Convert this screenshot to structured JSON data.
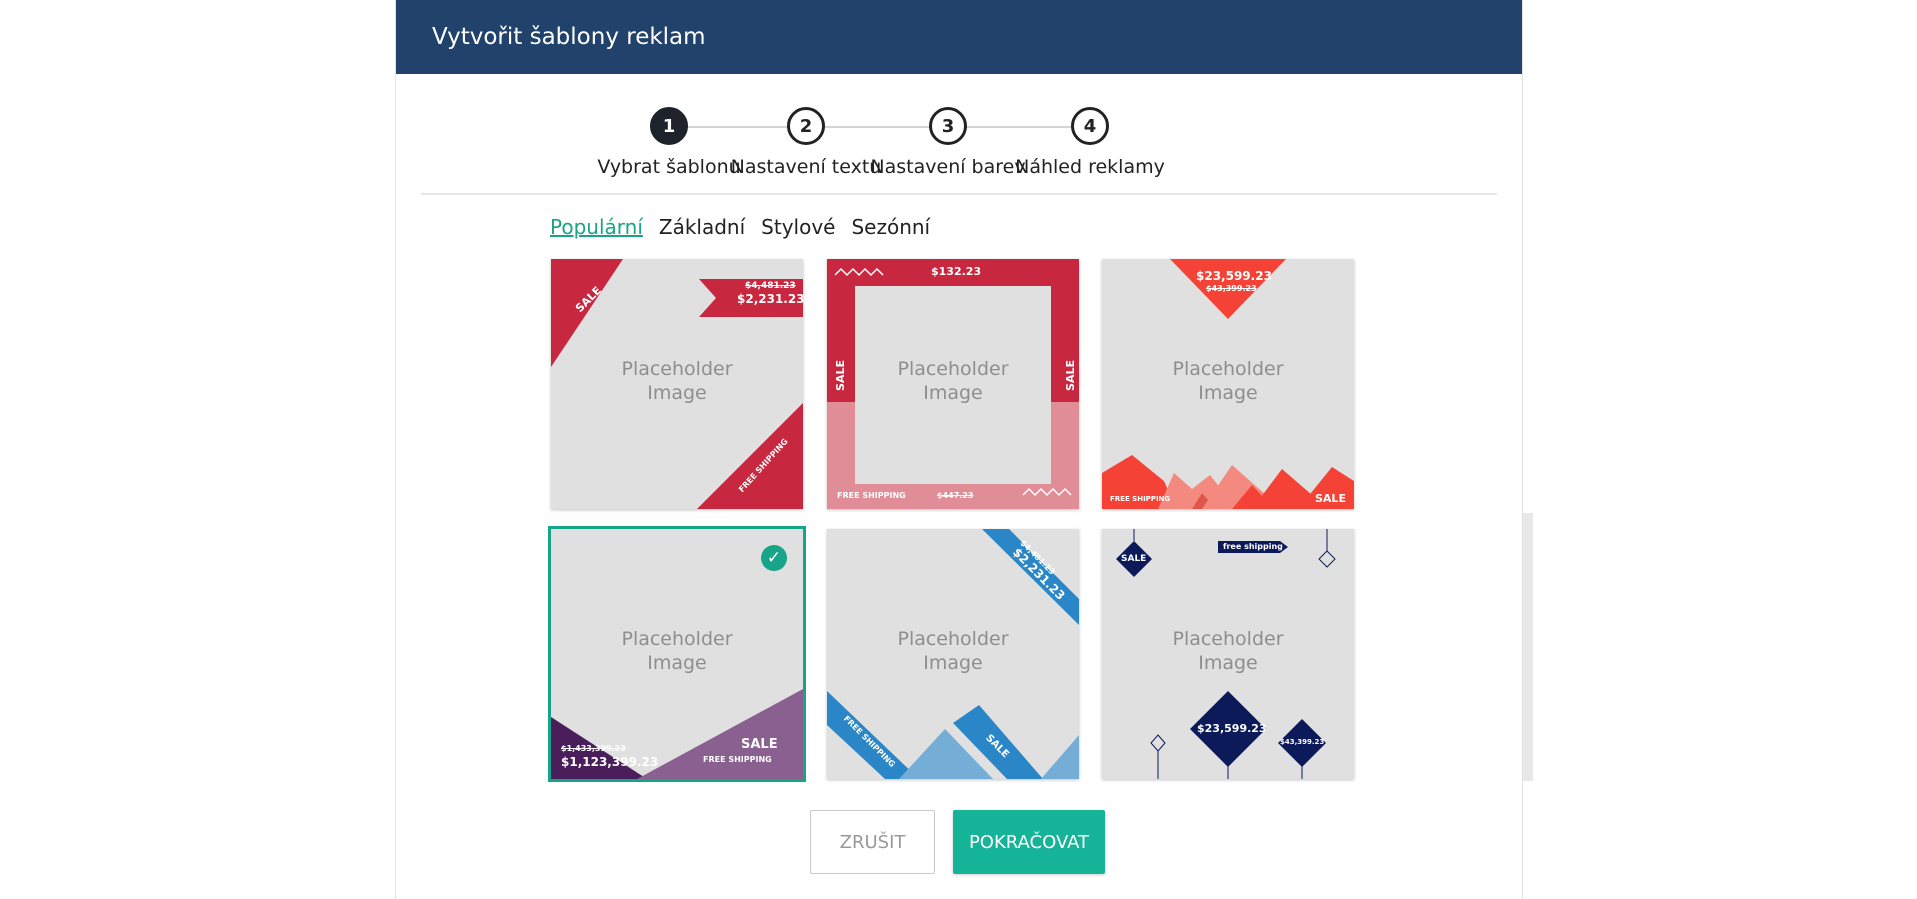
{
  "header": {
    "title": "Vytvořit šablony reklam"
  },
  "steps": [
    {
      "number": "1",
      "label": "Vybrat šablonu",
      "active": true
    },
    {
      "number": "2",
      "label": "Nastavení textu",
      "active": false
    },
    {
      "number": "3",
      "label": "Nastavení barev",
      "active": false
    },
    {
      "number": "4",
      "label": "Náhled reklamy",
      "active": false
    }
  ],
  "tabs": [
    {
      "label": "Populární",
      "active": true
    },
    {
      "label": "Základní",
      "active": false
    },
    {
      "label": "Stylové",
      "active": false
    },
    {
      "label": "Sezónní",
      "active": false
    }
  ],
  "placeholder": {
    "line1": "Placeholder",
    "line2": "Image"
  },
  "templates": [
    {
      "colors": [
        "#c8283f"
      ],
      "texts": {
        "sale": "SALE",
        "old_price": "$4,481.23",
        "price": "$2,231.23",
        "shipping": "FREE SHIPPING"
      }
    },
    {
      "colors": [
        "#c8283f",
        "#e08d98"
      ],
      "texts": {
        "price": "$132.23",
        "sale": "SALE",
        "shipping": "FREE SHIPPING",
        "old_price": "$447.23"
      }
    },
    {
      "colors": [
        "#f44336",
        "#f48a7f"
      ],
      "texts": {
        "price": "$23,599.23",
        "old_price": "$43,399.23",
        "shipping": "FREE SHIPPING",
        "sale": "SALE"
      }
    },
    {
      "colors": [
        "#4a1e5a",
        "#8a6090"
      ],
      "selected": true,
      "texts": {
        "old_price": "$1,433,399.23",
        "price": "$1,123,399.23",
        "sale": "SALE",
        "shipping": "FREE SHIPPING"
      }
    },
    {
      "colors": [
        "#2a86c6",
        "#74aed6"
      ],
      "texts": {
        "old_price": "$4,481.23",
        "price": "$2,231.23",
        "shipping": "FREE SHIPPING",
        "sale": "SALE"
      }
    },
    {
      "colors": [
        "#0d1a5a"
      ],
      "texts": {
        "sale": "SALE",
        "shipping": "free shipping",
        "price": "$23,599.23",
        "old_price": "$43,399.23"
      }
    }
  ],
  "buttons": {
    "cancel": "ZRUŠIT",
    "continue": "POKRAČOVAT"
  }
}
